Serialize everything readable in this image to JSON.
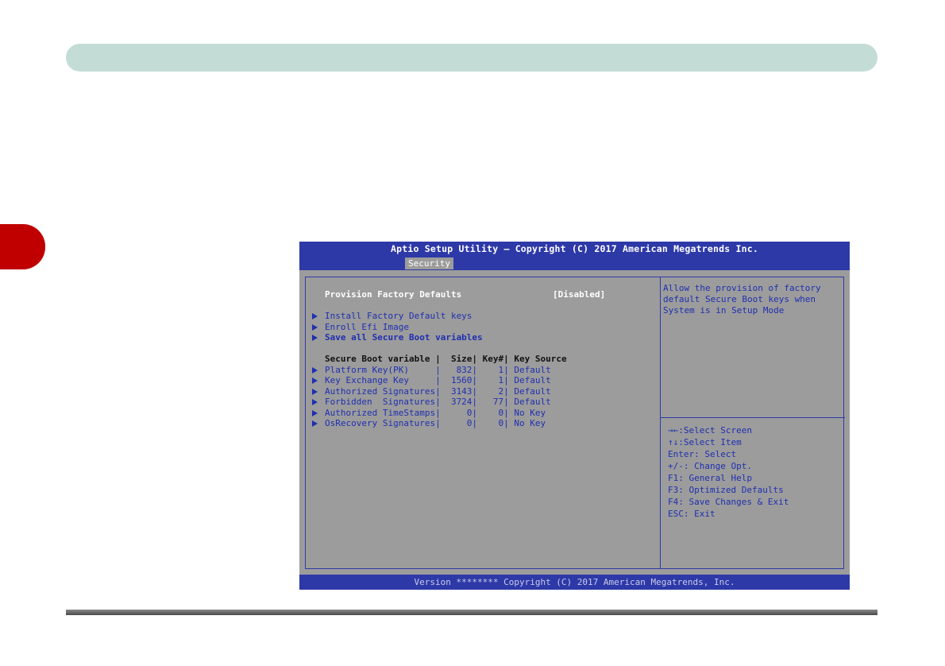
{
  "bios": {
    "title": "Aptio Setup Utility – Copyright (C) 2017 American Megatrends Inc.",
    "active_tab": "Security",
    "footer": "Version ******** Copyright (C) 2017 American Megatrends, Inc.",
    "provision": {
      "label": "Provision Factory Defaults",
      "value": "[Disabled]"
    },
    "menu_items": [
      "Install Factory Default keys",
      "Enroll Efi Image",
      "Save all Secure Boot variables"
    ],
    "table_header": "Secure Boot variable |  Size| Key#| Key Source",
    "table_rows": [
      "Platform Key(PK)     |   832|    1| Default",
      "Key Exchange Key     |  1560|    1| Default",
      "Authorized Signatures|  3143|    2| Default",
      "Forbidden  Signatures|  3724|   77| Default",
      "Authorized TimeStamps|     0|    0| No Key",
      "OsRecovery Signatures|     0|    0| No Key"
    ],
    "help_text": [
      "Allow the provision of factory",
      "default Secure Boot keys when",
      "System is in Setup Mode"
    ],
    "keys": [
      "→←:Select Screen",
      "↑↓:Select Item",
      "Enter: Select",
      "+/-: Change Opt.",
      "F1: General Help",
      "F3: Optimized Defaults",
      "F4: Save Changes & Exit",
      "ESC: Exit"
    ]
  },
  "colors": {
    "bios_blue": "#2e39a8",
    "bios_gray": "#9c9c9c",
    "header_bar": "#c4dcd6",
    "chapter_tab": "#c00000"
  }
}
